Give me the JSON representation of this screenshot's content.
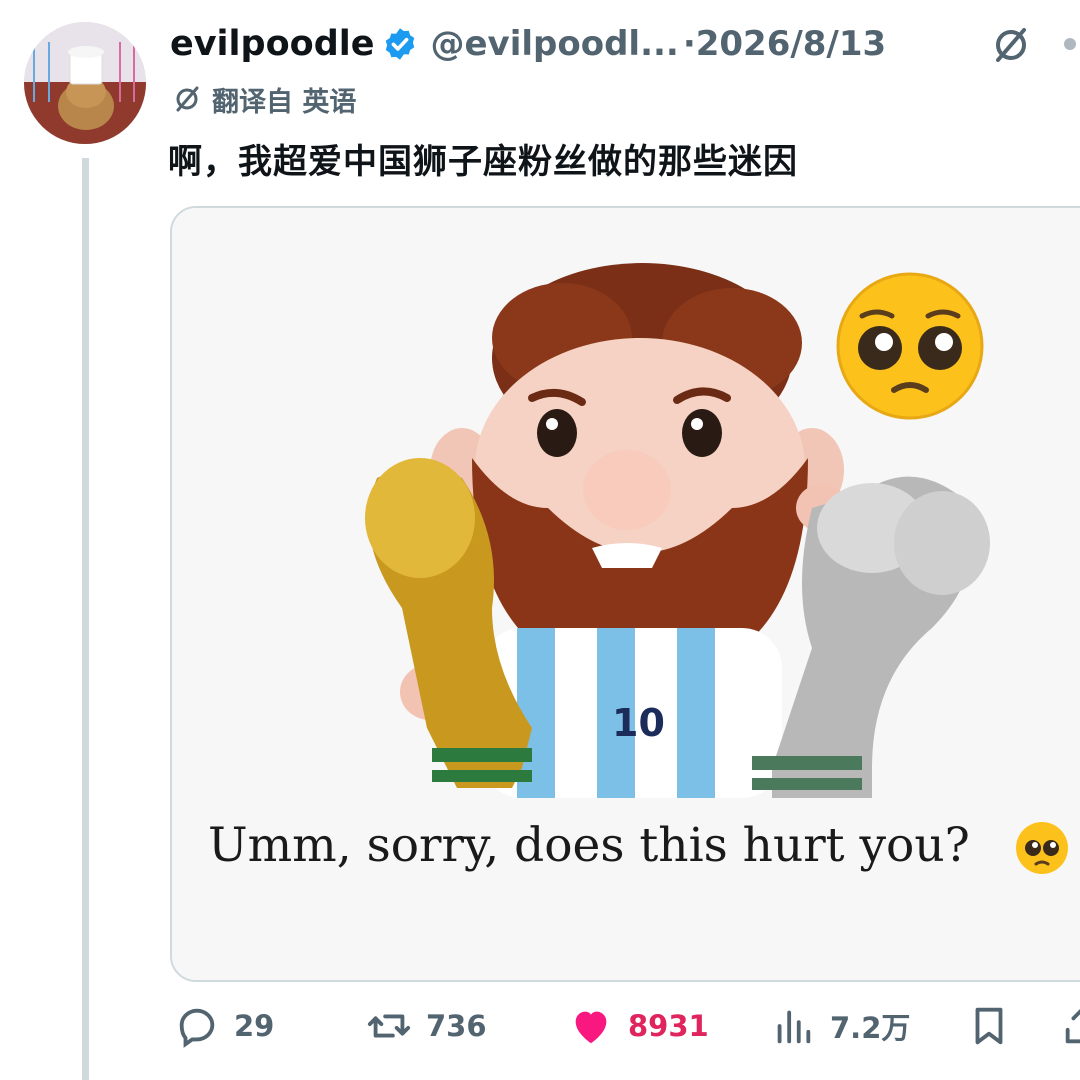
{
  "tweet": {
    "display_name": "evilpoodle",
    "handle": "@evilpoodl...",
    "date": "·2026/8/13",
    "translated_from": "翻译自 英语",
    "text": "啊，我超爱中国狮子座粉丝做的那些迷因"
  },
  "media": {
    "caption": "Umm, sorry, does this hurt you?",
    "jersey_number": "10",
    "emoji": "pleading-face-emoji"
  },
  "actions": {
    "replies": "29",
    "retweets": "736",
    "likes": "8931",
    "views": "7.2万"
  },
  "icons": {
    "verified": "verified-badge-icon",
    "grok": "grok-icon",
    "reply": "reply-icon",
    "retweet": "retweet-icon",
    "like": "heart-icon",
    "views": "views-icon",
    "bookmark": "bookmark-icon",
    "share": "share-icon"
  },
  "colors": {
    "verified_blue": "#1d9bf0",
    "like_pink": "#e0245e",
    "muted_text": "#536471",
    "border": "#cfd9de"
  }
}
